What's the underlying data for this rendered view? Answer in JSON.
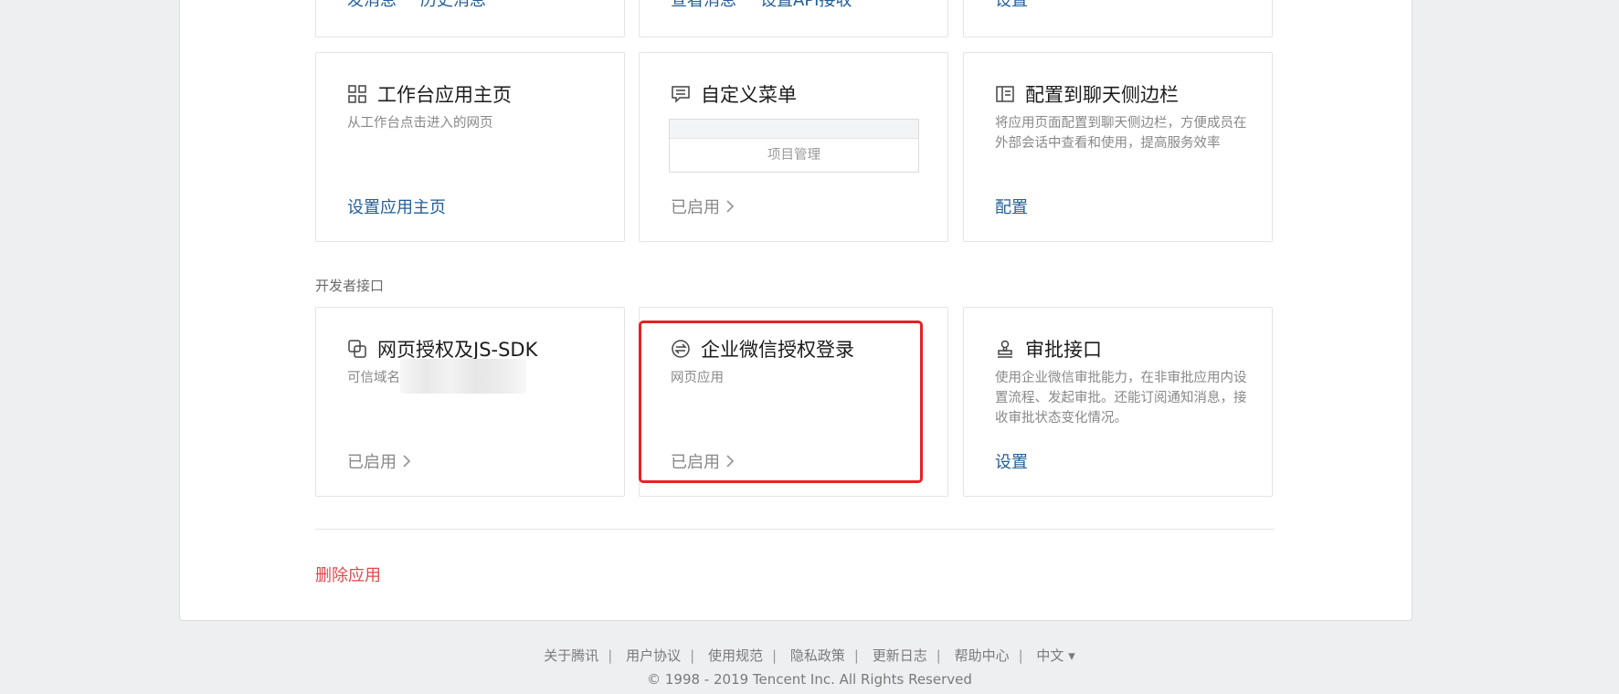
{
  "top_row": {
    "card1_links": [
      "发消息",
      "历史消息"
    ],
    "card2_links": [
      "查看消息",
      "设置API接收"
    ],
    "card3_link": "设置"
  },
  "cards_row2": {
    "workbench": {
      "title": "工作台应用主页",
      "desc": "从工作台点击进入的网页",
      "link": "设置应用主页",
      "icon": "grid-icon"
    },
    "custom_menu": {
      "title": "自定义菜单",
      "menu_item": "项目管理",
      "status": "已启用",
      "icon": "menu-card-icon"
    },
    "sidebar": {
      "title": "配置到聊天侧边栏",
      "desc": "将应用页面配置到聊天侧边栏，方便成员在外部会话中查看和使用，提高服务效率",
      "link": "配置",
      "icon": "sidebar-panel-icon"
    }
  },
  "developer_section": {
    "label": "开发者接口",
    "web_auth": {
      "title": "网页授权及JS-SDK",
      "desc": "可信域名",
      "status": "已启用",
      "icon": "overlap-squares-icon"
    },
    "wework_login": {
      "title": "企业微信授权登录",
      "desc": "网页应用",
      "status": "已启用",
      "icon": "exchange-circle-icon"
    },
    "approval": {
      "title": "审批接口",
      "desc": "使用企业微信审批能力，在非审批应用内设置流程、发起审批。还能订阅通知消息，接收审批状态变化情况。",
      "link": "设置",
      "icon": "stamp-icon"
    }
  },
  "delete_app": "删除应用",
  "footer": {
    "links": [
      "关于腾讯",
      "用户协议",
      "使用规范",
      "隐私政策",
      "更新日志",
      "帮助中心"
    ],
    "language": "中文 ▾",
    "copyright": "© 1998 - 2019 Tencent Inc. All Rights Reserved"
  },
  "colors": {
    "link": "#215e9a",
    "danger": "#e0494a",
    "highlight": "#e52222",
    "background": "#eeeff1"
  }
}
